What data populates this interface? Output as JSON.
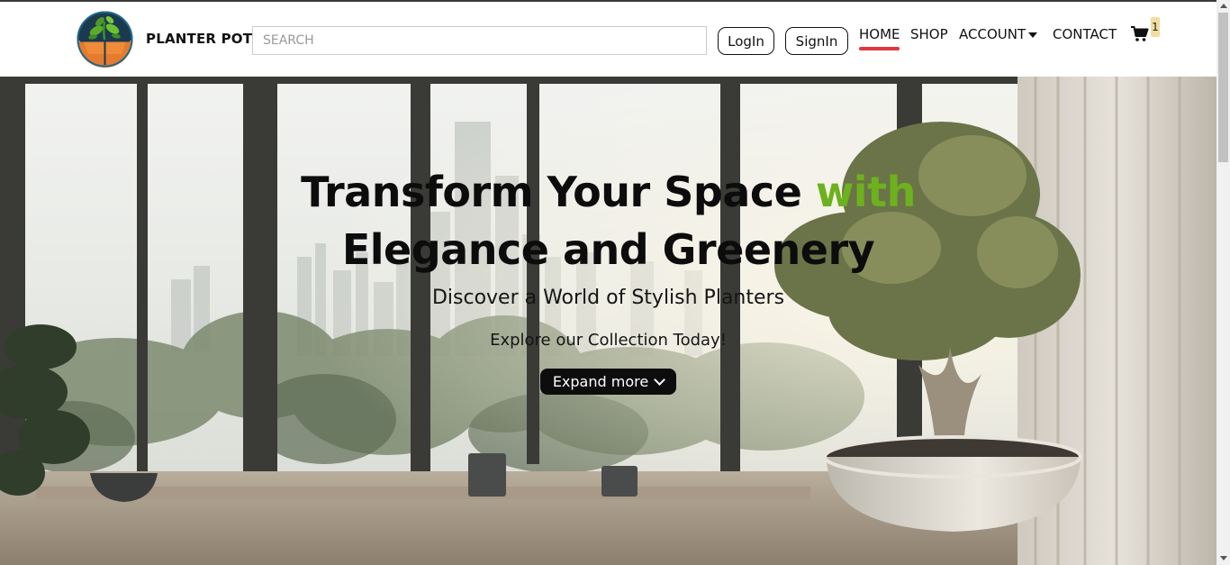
{
  "header": {
    "brand": "PLANTER POT",
    "search_placeholder": "SEARCH",
    "login_label": "LogIn",
    "signin_label": "SignIn",
    "nav": {
      "home": "HOME",
      "shop": "SHOP",
      "account": "ACCOUNT",
      "contact": "CONTACT"
    },
    "active_nav": "HOME",
    "cart_count": "1",
    "icons": {
      "logo": "planter-logo",
      "cart": "cart-icon",
      "account_dropdown": "caret-down-icon"
    }
  },
  "hero": {
    "title_part1": "Transform Your Space ",
    "title_accent": "with",
    "title_line2": "Elegance and Greenery",
    "subtitle": "Discover a World of Stylish Planters",
    "tagline": "Explore our Collection Today!",
    "expand_label": "Expand more",
    "icons": {
      "expand": "chevron-down-icon"
    }
  },
  "colors": {
    "accent_green": "#6db11e",
    "home_underline": "#e0383d",
    "cart_badge": "#f3dd9e",
    "button_dark": "#0d0d0d"
  }
}
